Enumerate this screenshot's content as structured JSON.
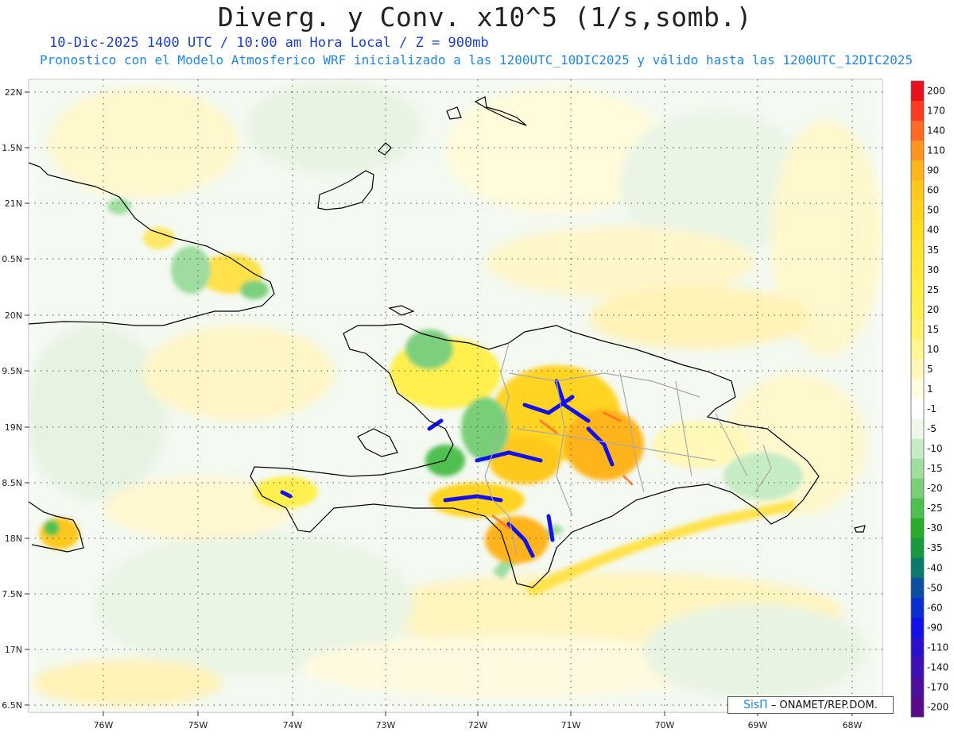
{
  "title": "Diverg. y Conv. x10^5 (1/s,somb.)",
  "subtitle_time": "10-Dic-2025  1400 UTC / 10:00 am Hora Local / Z = 900mb",
  "subtitle_model": "Pronostico con el Modelo Atmosferico WRF inicializado a las 1200UTC_10DIC2025 y válido hasta las  1200UTC_12DIC2025",
  "credit": {
    "brand": "SisΠ",
    "text": "– ONAMET/REP.DOM."
  },
  "lat_labels": [
    "22N",
    "1.5N",
    "21N",
    "0.5N",
    "20N",
    "9.5N",
    "19N",
    "8.5N",
    "18N",
    "7.5N",
    "17N",
    "6.5N"
  ],
  "lon_labels": [
    "76W",
    "75W",
    "74W",
    "73W",
    "72W",
    "71W",
    "70W",
    "69W",
    "68W"
  ],
  "colorbar": {
    "labels": [
      "200",
      "170",
      "140",
      "110",
      "90",
      "60",
      "50",
      "40",
      "35",
      "30",
      "25",
      "20",
      "15",
      "10",
      "5",
      "1",
      "-1",
      "-5",
      "-10",
      "-15",
      "-20",
      "-25",
      "-30",
      "-35",
      "-40",
      "-50",
      "-60",
      "-90",
      "-110",
      "-140",
      "-170",
      "-200"
    ],
    "colors": [
      "#e8101c",
      "#ff3a20",
      "#ff6a22",
      "#ff9420",
      "#ffb41c",
      "#ffc81a",
      "#ffd420",
      "#ffde22",
      "#ffe430",
      "#ffe838",
      "#ffee44",
      "#fff050",
      "#fff468",
      "#fff690",
      "#fff8b8",
      "#fffce0",
      "#ffffff",
      "#eef7ea",
      "#c6ecc6",
      "#a0dea0",
      "#78cf78",
      "#4fc04f",
      "#27ad27",
      "#159a3e",
      "#0a7a6a",
      "#0a4fa0",
      "#0a2ed0",
      "#1212e8",
      "#2a10cc",
      "#3c10b4",
      "#4c0e9c",
      "#5a0a88"
    ]
  },
  "icons": {
    "logo": "sispi-logo"
  }
}
